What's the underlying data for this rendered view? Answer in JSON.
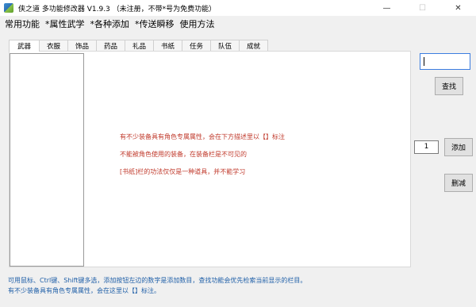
{
  "window": {
    "title": "侠之道 多功能修改器 V1.9.3 （未注册，不带*号为免费功能）",
    "minimize_glyph": "—",
    "maximize_glyph": "☐",
    "close_glyph": "✕"
  },
  "menu": [
    "常用功能",
    "*属性武学",
    "*各种添加",
    "*传送瞬移",
    "使用方法"
  ],
  "tabs": [
    "武器",
    "衣服",
    "饰品",
    "药品",
    "礼品",
    "书纸",
    "任务",
    "队伍",
    "成就"
  ],
  "active_tab": 0,
  "notes": [
    "有不少装备具有角色专属属性，会在下方描述里以【】标注",
    "不能被角色使用的装备，在装备栏是不可见的",
    "[书纸]栏的功法仅仅是一种道具，并不能学习"
  ],
  "search": {
    "value": "",
    "button": "查找"
  },
  "quantity": {
    "value": "1",
    "button": "添加"
  },
  "delete_button": "删减",
  "footer": [
    "可用鼠标、Ctrl键、Shift键多选，添加按钮左边的数字是添加数目，查找功能会优先检索当前显示的栏目。",
    "有不少装备具有角色专属属性，会在这里以【】标注。"
  ],
  "colors": {
    "note": "#c0392b",
    "footer": "#1f5fa8",
    "accent": "#3b7de0"
  }
}
